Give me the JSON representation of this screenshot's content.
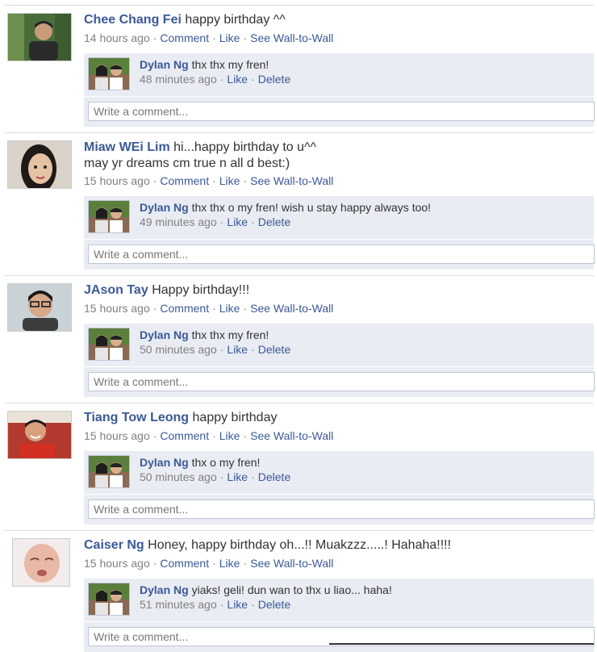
{
  "posts": [
    {
      "author": "Chee Chang Fei",
      "message": "happy birthday ^^",
      "time": "14 hours ago",
      "actions": [
        "Comment",
        "Like",
        "See Wall-to-Wall"
      ],
      "reply": {
        "author": "Dylan Ng",
        "message": "thx thx my fren!",
        "time": "48 minutes ago",
        "actions": [
          "Like",
          "Delete"
        ]
      }
    },
    {
      "author": "Miaw WEi Lim",
      "message": "hi...happy birthday to u^^",
      "message2": "may yr dreams cm true n all d best:)",
      "time": "15 hours ago",
      "actions": [
        "Comment",
        "Like",
        "See Wall-to-Wall"
      ],
      "reply": {
        "author": "Dylan Ng",
        "message": "thx thx o my fren! wish u stay happy always too!",
        "time": "49 minutes ago",
        "actions": [
          "Like",
          "Delete"
        ]
      }
    },
    {
      "author": "JAson Tay",
      "message": "Happy birthday!!!",
      "time": "15 hours ago",
      "actions": [
        "Comment",
        "Like",
        "See Wall-to-Wall"
      ],
      "reply": {
        "author": "Dylan Ng",
        "message": "thx thx my fren!",
        "time": "50 minutes ago",
        "actions": [
          "Like",
          "Delete"
        ]
      }
    },
    {
      "author": "Tiang Tow Leong",
      "message": "happy birthday",
      "time": "15 hours ago",
      "actions": [
        "Comment",
        "Like",
        "See Wall-to-Wall"
      ],
      "reply": {
        "author": "Dylan Ng",
        "message": "thx o my fren!",
        "time": "50 minutes ago",
        "actions": [
          "Like",
          "Delete"
        ]
      }
    },
    {
      "author": "Caiser Ng",
      "message": "Honey, happy birthday oh...!! Muakzzz.....! Hahaha!!!!",
      "time": "15 hours ago",
      "actions": [
        "Comment",
        "Like",
        "See Wall-to-Wall"
      ],
      "reply": {
        "author": "Dylan Ng",
        "message": "yiaks! geli! dun wan to thx u liao... haha!",
        "time": "51 minutes ago",
        "actions": [
          "Like",
          "Delete"
        ]
      }
    }
  ],
  "comment_placeholder": "Write a comment...",
  "colors": {
    "link": "#3b5998",
    "meta": "#808080",
    "reply_bg": "#e9ecf3",
    "input_border": "#bdc7d8"
  }
}
